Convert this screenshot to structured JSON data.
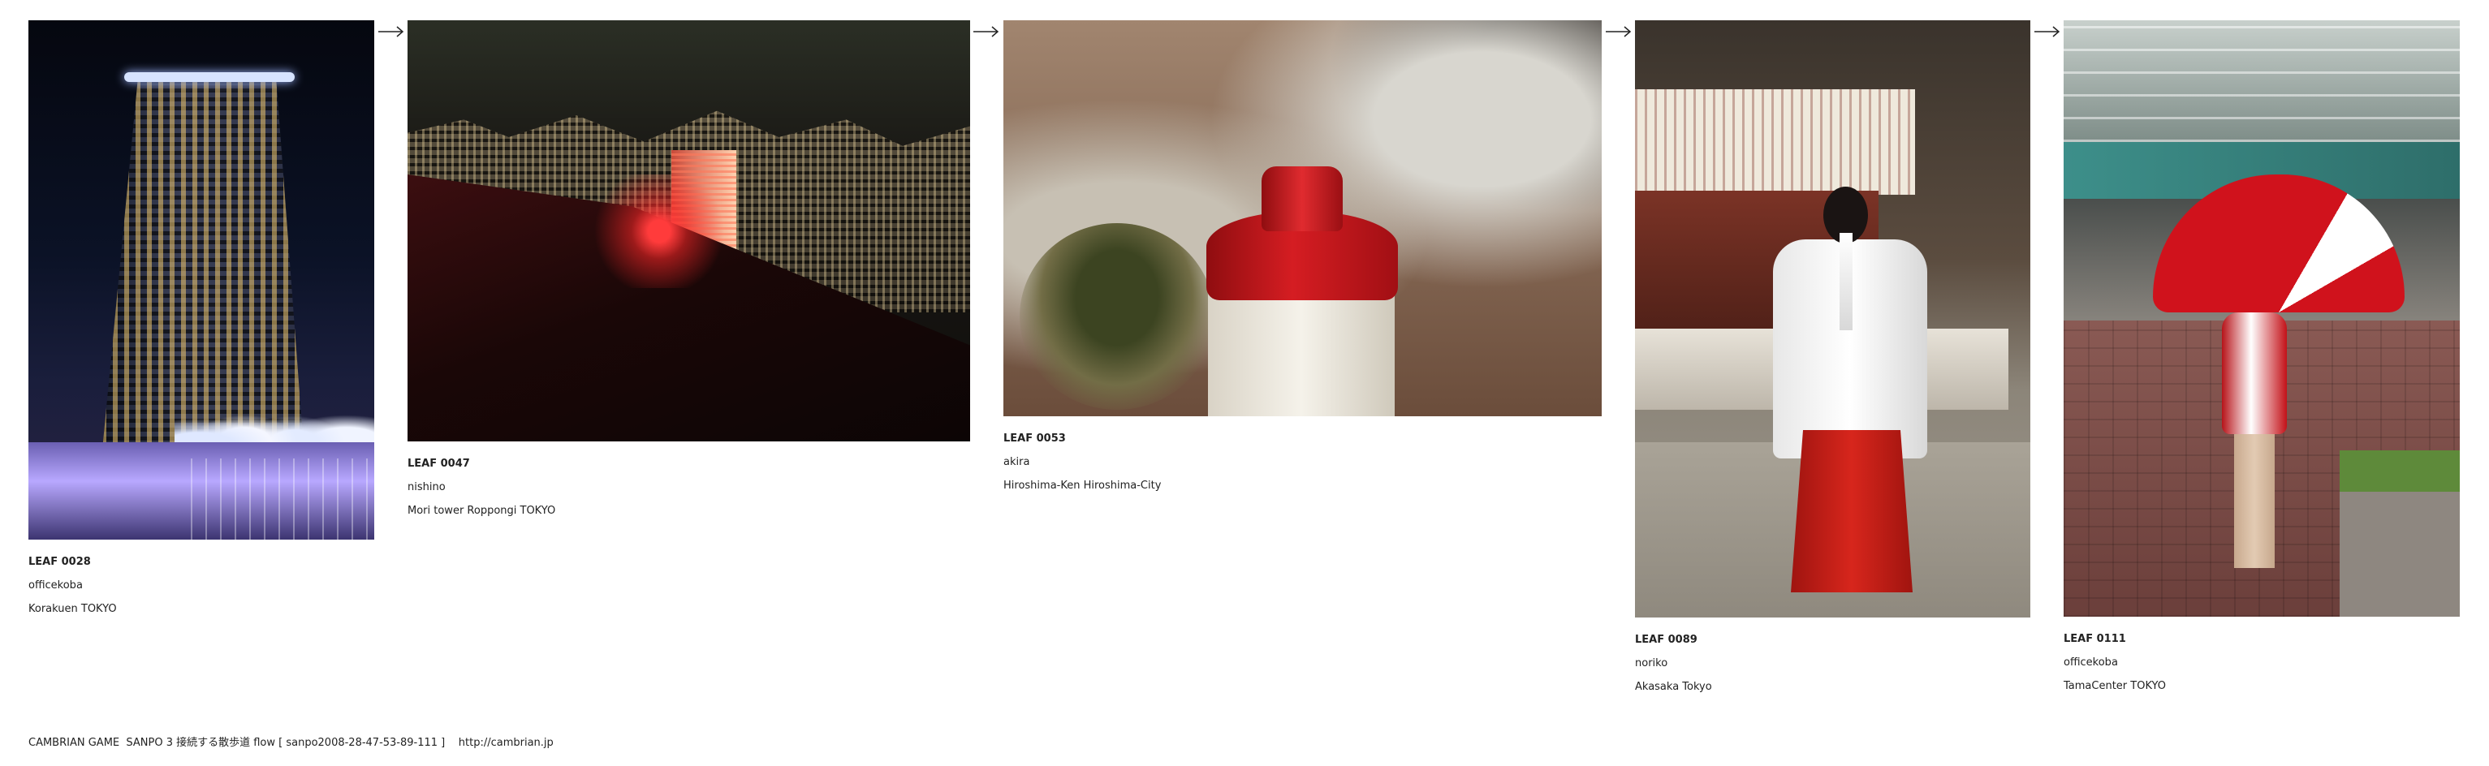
{
  "cards": [
    {
      "leaf": "LEAF 0028",
      "author": "officekoba",
      "place": "Korakuen TOKYO"
    },
    {
      "leaf": "LEAF 0047",
      "author": "nishino",
      "place": "Mori tower Roppongi TOKYO"
    },
    {
      "leaf": "LEAF 0053",
      "author": "akira",
      "place": "Hiroshima-Ken Hiroshima-City"
    },
    {
      "leaf": "LEAF 0089",
      "author": "noriko",
      "place": "Akasaka Tokyo"
    },
    {
      "leaf": "LEAF 0111",
      "author": "officekoba",
      "place": "TamaCenter TOKYO"
    }
  ],
  "arrows": [
    "right-arrow-icon",
    "right-arrow-icon",
    "right-arrow-icon",
    "right-arrow-icon"
  ],
  "footer": {
    "text": "CAMBRIAN GAME  SANPO 3 接続する散歩道 flow [ sanpo2008-28-47-53-89-111 ]    http://cambrian.jp"
  }
}
